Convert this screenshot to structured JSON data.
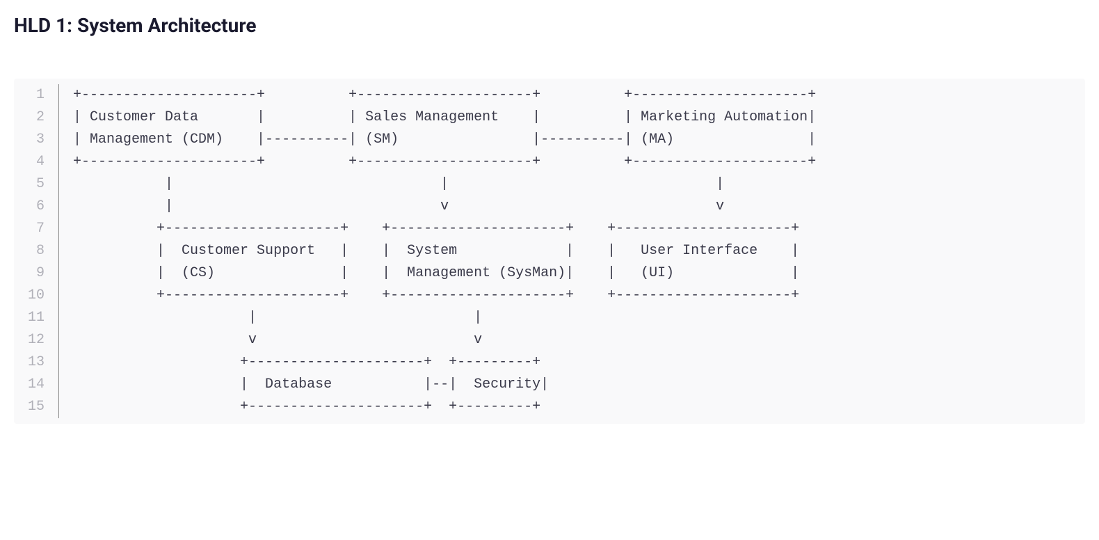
{
  "heading": "HLD 1: System Architecture",
  "lineNumbers": [
    "1",
    "2",
    "3",
    "4",
    "5",
    "6",
    "7",
    "8",
    "9",
    "10",
    "11",
    "12",
    "13",
    "14",
    "15"
  ],
  "codeLines": [
    "+---------------------+          +---------------------+          +---------------------+",
    "| Customer Data       |          | Sales Management    |          | Marketing Automation|",
    "| Management (CDM)    |----------| (SM)                |----------| (MA)                |",
    "+---------------------+          +---------------------+          +---------------------+",
    "           |                                |                                |",
    "           |                                v                                v",
    "          +---------------------+    +---------------------+    +---------------------+",
    "          |  Customer Support   |    |  System             |    |   User Interface    |",
    "          |  (CS)               |    |  Management (SysMan)|    |   (UI)              |",
    "          +---------------------+    +---------------------+    +---------------------+",
    "                     |                          |",
    "                     v                          v",
    "                    +---------------------+  +---------+",
    "                    |  Database           |--|  Security|",
    "                    +---------------------+  +---------+"
  ]
}
